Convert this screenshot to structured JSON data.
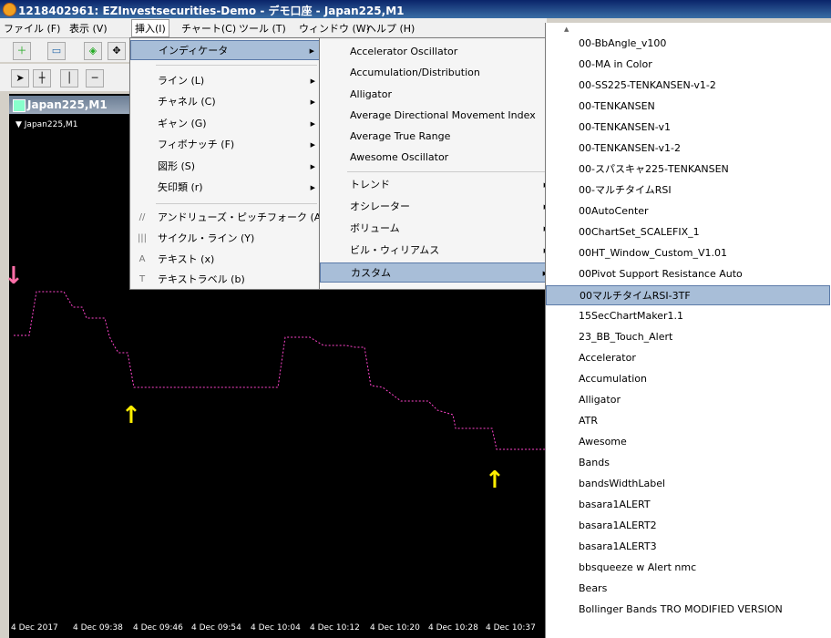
{
  "window": {
    "title": "1218402961: EZInvestsecurities-Demo - デモ口座 - Japan225,M1"
  },
  "menubar": [
    "ファイル (F)",
    "表示 (V)",
    "挿入(I)",
    "チャート(C)",
    "ツール (T)",
    "ウィンドウ (W)",
    "ヘルプ (H)"
  ],
  "chart_window": {
    "caption": "Japan225,M1",
    "symbol_label": "▼ Japan225,M1"
  },
  "time_axis": [
    "4 Dec 2017",
    "4 Dec 09:38",
    "4 Dec 09:46",
    "4 Dec 09:54",
    "4 Dec 10:04",
    "4 Dec 10:12",
    "4 Dec 10:20",
    "4 Dec 10:28",
    "4 Dec 10:37"
  ],
  "colors": {
    "line": "#ff44cc",
    "down_arrow": "#ff6fa8",
    "up_arrow": "#ffee00",
    "selection": "#a8bed8"
  },
  "insert_menu": [
    {
      "label": "インディケータ",
      "icon": "",
      "submenu": true,
      "selected": true
    },
    {
      "label": "ライン (L)",
      "icon": "",
      "submenu": true
    },
    {
      "label": "チャネル (C)",
      "icon": "",
      "submenu": true
    },
    {
      "label": "ギャン (G)",
      "icon": "",
      "submenu": true
    },
    {
      "label": "フィボナッチ (F)",
      "icon": "",
      "submenu": true
    },
    {
      "label": "図形 (S)",
      "icon": "",
      "submenu": true
    },
    {
      "label": "矢印類 (r)",
      "icon": "",
      "submenu": true
    },
    {
      "label": "アンドリューズ・ピッチフォーク (A)",
      "icon": "//",
      "submenu": false
    },
    {
      "label": "サイクル・ライン (Y)",
      "icon": "|||",
      "submenu": false
    },
    {
      "label": "テキスト (x)",
      "icon": "A",
      "submenu": false
    },
    {
      "label": "テキストラベル (b)",
      "icon": "T",
      "submenu": false
    }
  ],
  "indicator_menu": [
    {
      "label": "Accelerator Oscillator",
      "submenu": false
    },
    {
      "label": "Accumulation/Distribution",
      "submenu": false
    },
    {
      "label": "Alligator",
      "submenu": false
    },
    {
      "label": "Average Directional Movement Index",
      "submenu": false
    },
    {
      "label": "Average True Range",
      "submenu": false
    },
    {
      "label": "Awesome Oscillator",
      "submenu": false
    },
    {
      "label": "トレンド",
      "submenu": true
    },
    {
      "label": "オシレーター",
      "submenu": true
    },
    {
      "label": "ボリューム",
      "submenu": true
    },
    {
      "label": "ビル・ウィリアムス",
      "submenu": true
    },
    {
      "label": "カスタム",
      "submenu": true,
      "selected": true
    }
  ],
  "custom_menu": [
    "00-BbAngle_v100",
    "00-MA in Color",
    "00-SS225-TENKANSEN-v1-2",
    "00-TENKANSEN",
    "00-TENKANSEN-v1",
    "00-TENKANSEN-v1-2",
    "00-スパスキャ225-TENKANSEN",
    "00-マルチタイムRSI",
    "00AutoCenter",
    "00ChartSet_SCALEFIX_1",
    "00HT_Window_Custom_V1.01",
    "00Pivot Support Resistance Auto",
    "00マルチタイムRSI-3TF",
    "15SecChartMaker1.1",
    "23_BB_Touch_Alert",
    "Accelerator",
    "Accumulation",
    "Alligator",
    "ATR",
    "Awesome",
    "Bands",
    "bandsWidthLabel",
    "basara1ALERT",
    "basara1ALERT2",
    "basara1ALERT3",
    "bbsqueeze w Alert nmc",
    "Bears",
    "Bollinger Bands TRO MODIFIED VERSION"
  ],
  "custom_selected_index": 12
}
